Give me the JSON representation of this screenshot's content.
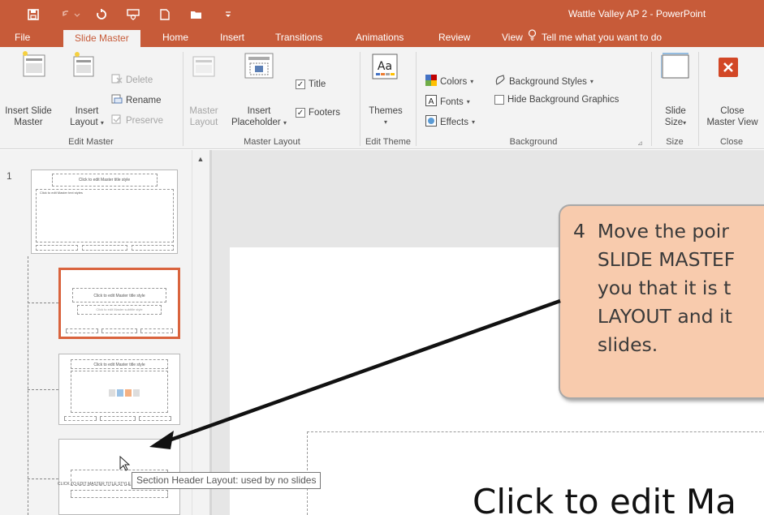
{
  "window": {
    "title": "Wattle Valley AP 2 - PowerPoint"
  },
  "quick_access": [
    "save-icon",
    "undo-icon",
    "redo-icon",
    "present-icon",
    "new-icon",
    "open-icon",
    "customize-icon"
  ],
  "tabs": [
    {
      "label": "File"
    },
    {
      "label": "Slide Master",
      "active": true
    },
    {
      "label": "Home"
    },
    {
      "label": "Insert"
    },
    {
      "label": "Transitions"
    },
    {
      "label": "Animations"
    },
    {
      "label": "Review"
    },
    {
      "label": "View"
    }
  ],
  "tell_me": "Tell me what you want to do",
  "ribbon": {
    "edit_master": {
      "insert_slide_master": [
        "Insert Slide",
        "Master"
      ],
      "insert_layout": [
        "Insert",
        "Layout"
      ],
      "delete": "Delete",
      "rename": "Rename",
      "preserve": "Preserve",
      "group": "Edit Master"
    },
    "master_layout": {
      "master_layout": [
        "Master",
        "Layout"
      ],
      "insert_placeholder": [
        "Insert",
        "Placeholder"
      ],
      "title": "Title",
      "footers": "Footers",
      "group": "Master Layout"
    },
    "edit_theme": {
      "themes": "Themes",
      "group": "Edit Theme"
    },
    "background": {
      "colors": "Colors",
      "fonts": "Fonts",
      "effects": "Effects",
      "background_styles": "Background Styles",
      "hide_background_graphics": "Hide Background Graphics",
      "group": "Background"
    },
    "size": {
      "slide_size": [
        "Slide",
        "Size"
      ],
      "group": "Size"
    },
    "close": {
      "close_master_view": [
        "Close",
        "Master View"
      ],
      "group": "Close"
    }
  },
  "slide_panel": {
    "slide_number": "1",
    "master_thumb_title": "Click to edit Master title style",
    "master_thumb_text": "Click to edit Master text styles",
    "layout_thumb_title": "Click to edit Master title style",
    "layout_thumb_subtitle": "Click to edit Master subtitle style",
    "section_thumb_title": "CLICK TO EDIT MASTER TITLE STYLE"
  },
  "tooltip": "Section Header Layout: used by no slides",
  "callout": {
    "text": "4  Move the poir\n    SLIDE MASTEF\n    you that it is t\n    LAYOUT and it\n    slides."
  },
  "slide": {
    "title_text": "Click to edit Ma"
  },
  "colors": {
    "accent": "#c75b39",
    "selection": "#d9633d",
    "callout_fill": "#f8cbad"
  }
}
